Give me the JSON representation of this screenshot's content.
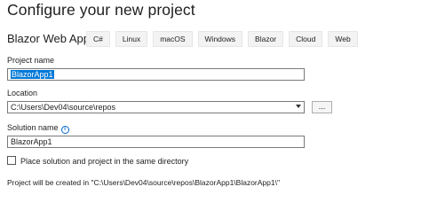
{
  "header": {
    "title": "Configure your new project"
  },
  "template": {
    "name": "Blazor Web App",
    "tags": [
      "C#",
      "Linux",
      "macOS",
      "Windows",
      "Blazor",
      "Cloud",
      "Web"
    ]
  },
  "form": {
    "project_name_label": "Project name",
    "project_name_value": "BlazorApp1",
    "location_label": "Location",
    "location_value": "C:\\Users\\Dev04\\source\\repos",
    "browse_label": "...",
    "solution_name_label": "Solution name",
    "solution_name_info": "i",
    "solution_name_value": "BlazorApp1",
    "same_directory_label": "Place solution and project in the same directory",
    "same_directory_checked": false,
    "footer": "Project will be created in \"C:\\Users\\Dev04\\source\\repos\\BlazorApp1\\BlazorApp1\\\""
  },
  "colors": {
    "selection": "#0078d7",
    "info_icon": "#0066cc"
  }
}
